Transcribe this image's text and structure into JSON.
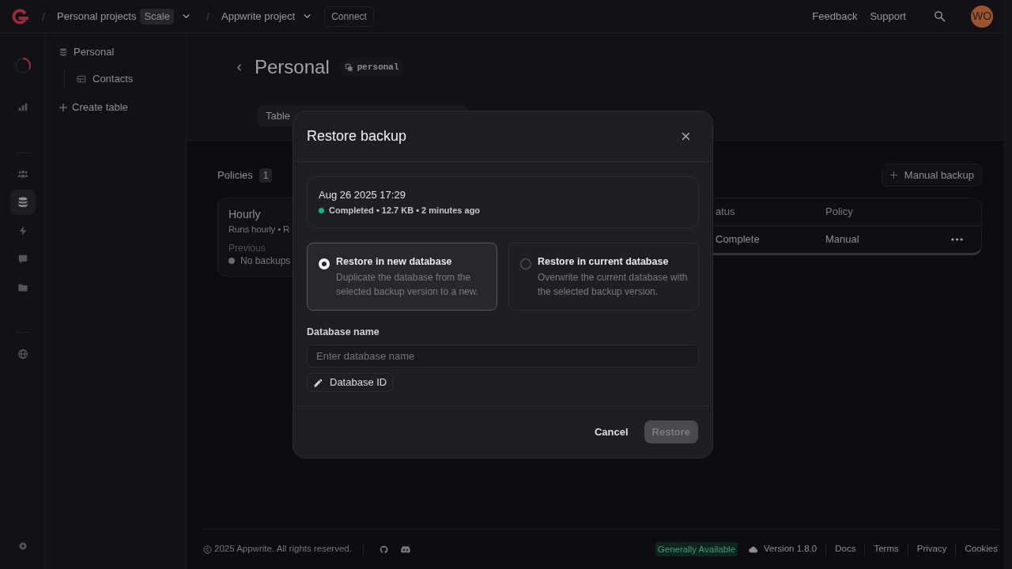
{
  "top_bar": {
    "breadcrumbs": [
      {
        "label": "Personal projects",
        "badge": "Scale"
      },
      {
        "label": "Appwrite project"
      }
    ],
    "connect_button": "Connect",
    "links": [
      "Feedback",
      "Support"
    ],
    "avatar": "WO"
  },
  "rail": {
    "groups": [
      [
        {
          "selected": false
        }
      ],
      [
        {
          "selected": false
        },
        {
          "selected": true
        },
        {
          "selected": false
        },
        {
          "selected": false
        },
        {
          "selected": false
        }
      ],
      [
        {
          "selected": false
        }
      ]
    ]
  },
  "sidebar": {
    "database": "Personal",
    "tables": [
      {
        "label": "Contacts"
      }
    ],
    "create_button": "Create table"
  },
  "page_header": {
    "title": "Personal",
    "id_badge": "personal",
    "tabs": [
      {
        "label": "Table",
        "selected": false
      }
    ]
  },
  "policies": {
    "title": "Policies",
    "count": "1",
    "cards": [
      {
        "name": "Hourly",
        "schedule": "Runs hourly • R",
        "previous_label": "Previous",
        "previous_status": "No backups"
      }
    ]
  },
  "manual_backup_button": "Manual backup",
  "backups_table": {
    "columns": [
      "atus",
      "Policy"
    ],
    "rows": [
      {
        "cells": [
          "Complete",
          "Manual"
        ]
      }
    ]
  },
  "modal": {
    "title": "Restore backup",
    "backup": {
      "date": "Aug 26 2025 17:29",
      "details": "Completed • 12.7 KB • 2 minutes ago"
    },
    "options": [
      {
        "title": "Restore in new database",
        "description": "Duplicate the database from the selected backup version to a new.",
        "selected": true
      },
      {
        "title": "Restore in current database",
        "description": "Overwrite the current database with the selected backup version.",
        "selected": false
      }
    ],
    "name_field": {
      "label": "Database name",
      "placeholder": "Enter database name"
    },
    "id_button": "Database ID",
    "cancel_button": "Cancel",
    "restore_button": {
      "label": "Restore",
      "disabled": true
    }
  },
  "footer": {
    "copyright": "2025 Appwrite. All rights reserved.",
    "badge": "Generally Available",
    "version": "Version 1.8.0",
    "links": [
      "Docs",
      "Terms",
      "Privacy",
      "Cookies"
    ]
  }
}
